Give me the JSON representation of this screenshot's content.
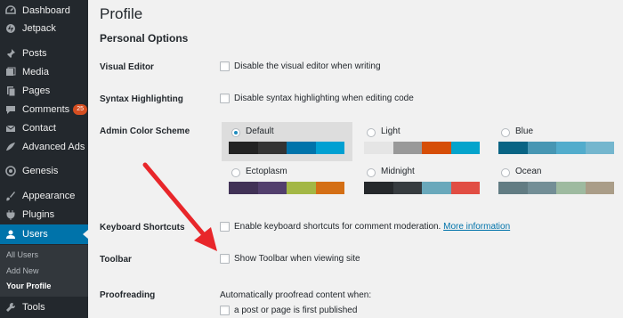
{
  "sidebar": {
    "items": [
      {
        "label": "Dashboard",
        "icon": "dashboard-icon"
      },
      {
        "label": "Jetpack",
        "icon": "jetpack-icon"
      },
      {
        "label": "Posts",
        "icon": "pin-icon"
      },
      {
        "label": "Media",
        "icon": "media-icon"
      },
      {
        "label": "Pages",
        "icon": "pages-icon"
      },
      {
        "label": "Comments",
        "icon": "comment-icon",
        "badge": "25"
      },
      {
        "label": "Contact",
        "icon": "envelope-icon"
      },
      {
        "label": "Advanced Ads",
        "icon": "ads-icon"
      },
      {
        "label": "Genesis",
        "icon": "genesis-icon"
      },
      {
        "label": "Appearance",
        "icon": "brush-icon"
      },
      {
        "label": "Plugins",
        "icon": "plug-icon"
      },
      {
        "label": "Users",
        "icon": "users-icon"
      },
      {
        "label": "Tools",
        "icon": "wrench-icon"
      }
    ],
    "submenu": [
      "All Users",
      "Add New",
      "Your Profile"
    ]
  },
  "main": {
    "title": "Profile",
    "section_title": "Personal Options",
    "visual_editor": {
      "label": "Visual Editor",
      "option": "Disable the visual editor when writing"
    },
    "syntax": {
      "label": "Syntax Highlighting",
      "option": "Disable syntax highlighting when editing code"
    },
    "color_scheme": {
      "label": "Admin Color Scheme",
      "schemes": [
        {
          "name": "Default",
          "selected": true,
          "colors": [
            "#222222",
            "#333333",
            "#0073aa",
            "#00a0d2"
          ]
        },
        {
          "name": "Light",
          "selected": false,
          "colors": [
            "#e5e5e5",
            "#999999",
            "#d64e07",
            "#04a4cc"
          ]
        },
        {
          "name": "Blue",
          "selected": false,
          "colors": [
            "#096484",
            "#4796b3",
            "#52accc",
            "#74b6ce"
          ]
        },
        {
          "name": "Ectoplasm",
          "selected": false,
          "colors": [
            "#413256",
            "#523f6d",
            "#a3b745",
            "#d46f15"
          ]
        },
        {
          "name": "Midnight",
          "selected": false,
          "colors": [
            "#25282b",
            "#363b3f",
            "#69a8bb",
            "#e14d43"
          ]
        },
        {
          "name": "Ocean",
          "selected": false,
          "colors": [
            "#627c83",
            "#738e96",
            "#9ebaa0",
            "#aa9d88"
          ]
        }
      ]
    },
    "keyboard": {
      "label": "Keyboard Shortcuts",
      "option": "Enable keyboard shortcuts for comment moderation.",
      "link": "More information"
    },
    "toolbar": {
      "label": "Toolbar",
      "option": "Show Toolbar when viewing site"
    },
    "proofreading": {
      "label": "Proofreading",
      "intro": "Automatically proofread content when:",
      "option": "a post or page is first published"
    }
  },
  "colors": {
    "sidebar_bg": "#23282d",
    "active_bg": "#0073aa",
    "arrow": "#e8262a",
    "badge": "#d54e21"
  }
}
